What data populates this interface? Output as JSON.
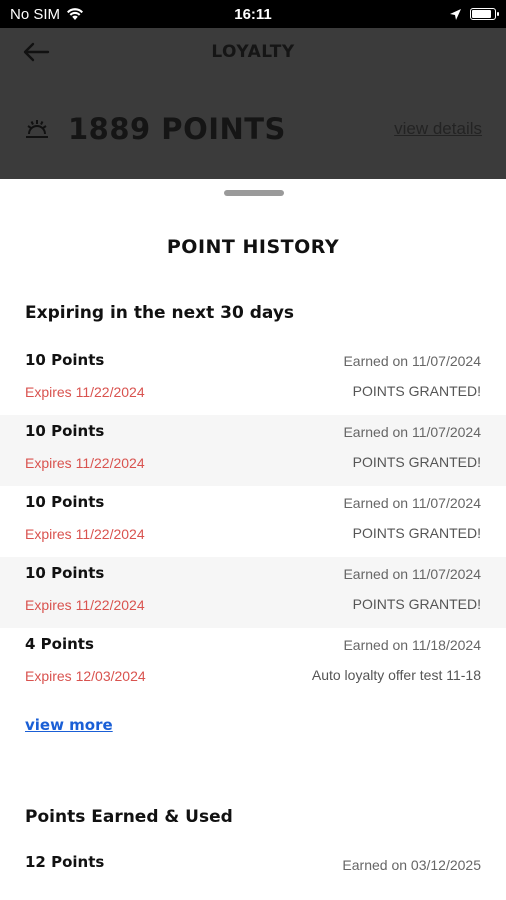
{
  "status_bar": {
    "carrier": "No SIM",
    "time": "16:11",
    "battery_level": 0.9
  },
  "header": {
    "title": "LOYALTY",
    "points": "1889 POINTS",
    "view_details": "view details"
  },
  "sheet": {
    "title": "POINT HISTORY",
    "expiring_section": {
      "title": "Expiring in the next 30 days",
      "entries": [
        {
          "points": "10 Points",
          "earned": "Earned on 11/07/2024",
          "expires": "Expires 11/22/2024",
          "note": "POINTS GRANTED!"
        },
        {
          "points": "10 Points",
          "earned": "Earned on 11/07/2024",
          "expires": "Expires 11/22/2024",
          "note": "POINTS GRANTED!"
        },
        {
          "points": "10 Points",
          "earned": "Earned on 11/07/2024",
          "expires": "Expires 11/22/2024",
          "note": "POINTS GRANTED!"
        },
        {
          "points": "10 Points",
          "earned": "Earned on 11/07/2024",
          "expires": "Expires 11/22/2024",
          "note": "POINTS GRANTED!"
        },
        {
          "points": "4 Points",
          "earned": "Earned on 11/18/2024",
          "expires": "Expires 12/03/2024",
          "note": "Auto loyalty offer test 11-18"
        }
      ],
      "view_more": "view more"
    },
    "earned_used_section": {
      "title": "Points Earned & Used",
      "entries": [
        {
          "points": "12 Points",
          "earned": "Earned on 03/12/2025"
        }
      ]
    }
  },
  "colors": {
    "header_bg": "#3b3b3b",
    "expires_red": "#d9534f",
    "link_blue": "#1a5fd6"
  }
}
